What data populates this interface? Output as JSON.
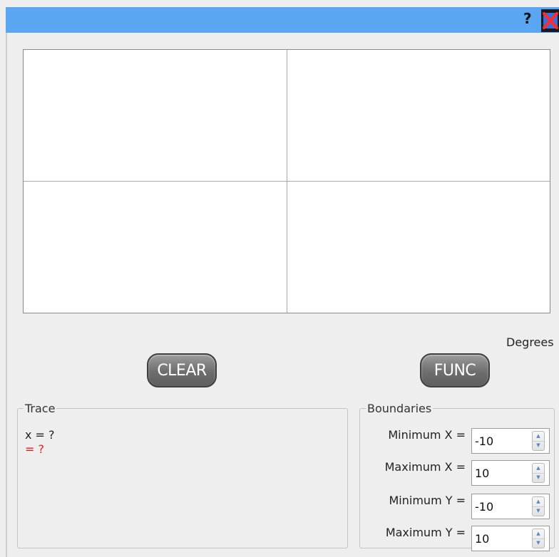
{
  "titlebar": {
    "help_icon": "question-mark",
    "help_text": "?",
    "close_icon": "close-x",
    "accent": "#5aa6f2"
  },
  "graph": {
    "background": "#ffffff",
    "axis_color": "#a9a9a9"
  },
  "mode_label": "Degrees",
  "buttons": {
    "clear_label": "CLEAR",
    "func_label": "FUNC"
  },
  "trace": {
    "legend": "Trace",
    "x_text": "x = ?",
    "y_text": "= ?",
    "y_color": "#e02020"
  },
  "boundaries": {
    "legend": "Boundaries",
    "rows": [
      {
        "label": "Minimum X =",
        "value": "-10"
      },
      {
        "label": "Maximum X =",
        "value": "10"
      },
      {
        "label": "Minimum Y =",
        "value": "-10"
      },
      {
        "label": "Maximum Y =",
        "value": "10"
      }
    ]
  }
}
